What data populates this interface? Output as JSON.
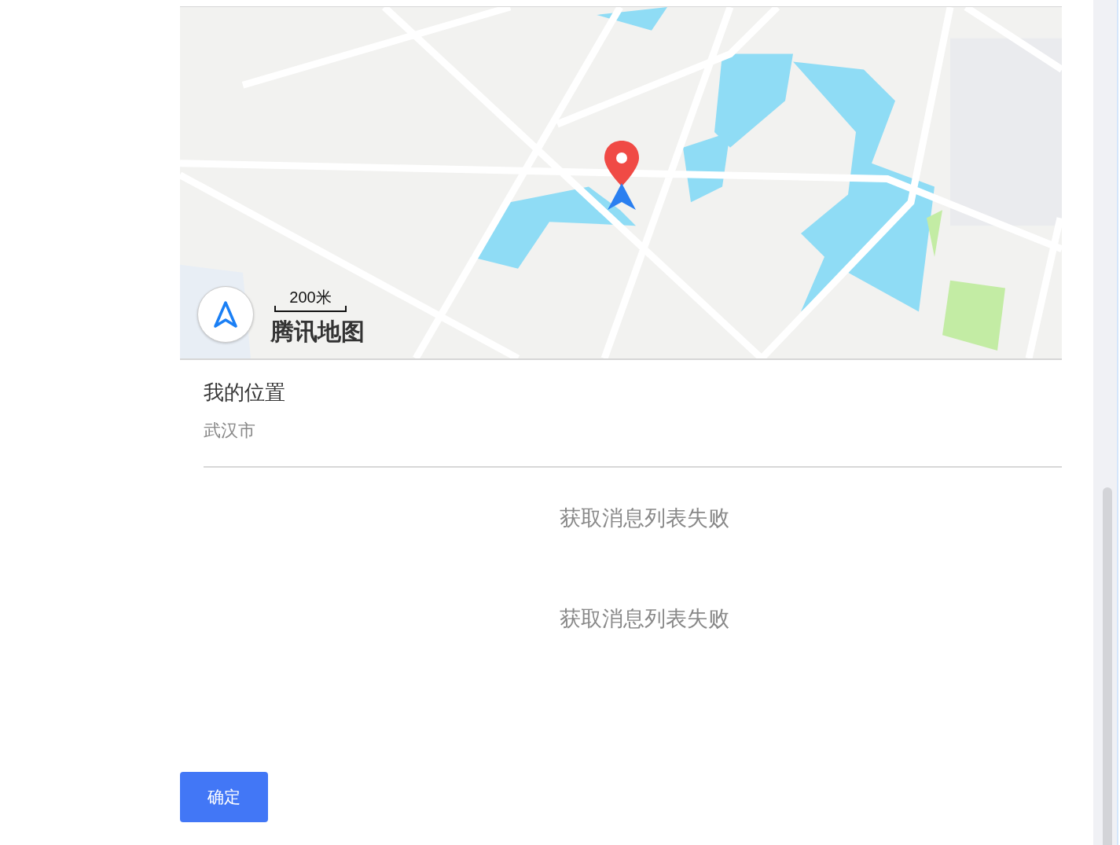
{
  "map": {
    "scale": "200米",
    "logo": "腾讯地图"
  },
  "location": {
    "title": "我的位置",
    "city": "武汉市"
  },
  "messages": [
    "获取消息列表失败",
    "获取消息列表失败"
  ],
  "confirm_button": "确定"
}
